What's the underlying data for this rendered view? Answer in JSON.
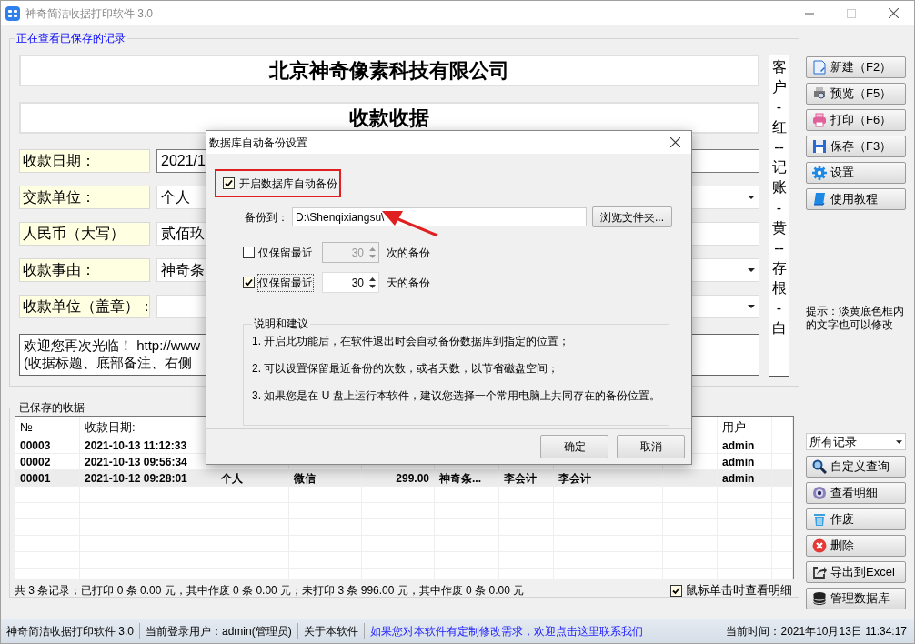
{
  "window": {
    "title": "神奇简洁收据打印软件 3.0"
  },
  "viewing_group": {
    "title": "正在查看已保存的记录",
    "company": "北京神奇像素科技有限公司",
    "receipt_title": "收款收据",
    "fields": [
      {
        "label": "收款日期：",
        "value": "2021/1",
        "kind": "date"
      },
      {
        "label": "交款单位：",
        "value": "个人",
        "kind": "dropdown"
      },
      {
        "label": "人民币（大写）",
        "value": "贰佰玖",
        "kind": "text"
      },
      {
        "label": "收款事由：",
        "value": "神奇条",
        "kind": "dropdown"
      },
      {
        "label": "收款单位（盖章）：",
        "kind": "dropdown"
      }
    ],
    "note_lines": [
      "欢迎您再次光临！ http://www",
      "(收据标题、底部备注、右侧"
    ],
    "copy_strip": "客户-红--记账-黄--存根-白"
  },
  "toolbar_buttons": [
    {
      "label": "新建（F2）"
    },
    {
      "label": "预览（F5）"
    },
    {
      "label": "打印（F6）"
    },
    {
      "label": "保存（F3）"
    },
    {
      "label": "设置"
    },
    {
      "label": "使用教程"
    }
  ],
  "hint": "提示：淡黄底色框内的文字也可以修改",
  "saved_group": {
    "title": "已保存的收据",
    "columns": {
      "column_1": "№",
      "column_2": "收款日期:",
      "column_11": "用户"
    },
    "rows": [
      {
        "selected": false,
        "column_1": "00003",
        "column_2": "2021-10-13 11:12:33",
        "column_11": "admin"
      },
      {
        "selected": false,
        "column_1": "00002",
        "column_2": "2021-10-13 09:56:34",
        "column_11": "admin"
      },
      {
        "selected": true,
        "column_1": "00001",
        "column_2": "2021-10-12 09:28:01",
        "column_3": "个人",
        "column_4": "微信",
        "column_5": "299.00",
        "column_6": "神奇条...",
        "column_7": "李会计",
        "column_8": "李会计",
        "column_11": "admin"
      }
    ],
    "summary": "共 3 条记录；已打印 0 条 0.00 元，其中作废 0 条 0.00 元；未打印 3 条 996.00 元，其中作废 0 条 0.00 元",
    "click_detail": {
      "label": "鼠标单击时查看明细",
      "checked": true
    }
  },
  "filter": {
    "value": "所有记录"
  },
  "side_buttons": [
    {
      "label": "自定义查询"
    },
    {
      "label": "查看明细"
    },
    {
      "label": "作废"
    },
    {
      "label": "删除"
    },
    {
      "label": "导出到Excel"
    },
    {
      "label": "管理数据库"
    }
  ],
  "status_bar": {
    "app": "神奇简洁收据打印软件 3.0",
    "user": "当前登录用户：admin(管理员)",
    "about": "关于本软件",
    "contact_link": "如果您对本软件有定制修改需求，欢迎点击这里联系我们",
    "time": "当前时间：2021年10月13日 11:34:17"
  },
  "dialog": {
    "title": "数据库自动备份设置",
    "enable_backup": {
      "label": "开启数据库自动备份",
      "checked": true
    },
    "backup_to": {
      "label": "备份到：",
      "value": "D:\\Shenqixiangsu\\"
    },
    "browse_button": "浏览文件夹...",
    "keep_rules": [
      {
        "label": "仅保留最近",
        "checked": false,
        "value": "30",
        "suffix": "次的备份"
      },
      {
        "label": "仅保留最近",
        "checked": true,
        "value": "30",
        "suffix": "天的备份"
      }
    ],
    "notes": {
      "title": "说明和建议",
      "lines": [
        "1. 开启此功能后，在软件退出时会自动备份数据库到指定的位置；",
        "2. 可以设置保留最近备份的次数，或者天数，以节省磁盘空间；",
        "3. 如果您是在 U 盘上运行本软件，建议您选择一个常用电脑上共同存在的备份位置。"
      ]
    },
    "buttons": [
      "确定",
      "取消"
    ]
  }
}
